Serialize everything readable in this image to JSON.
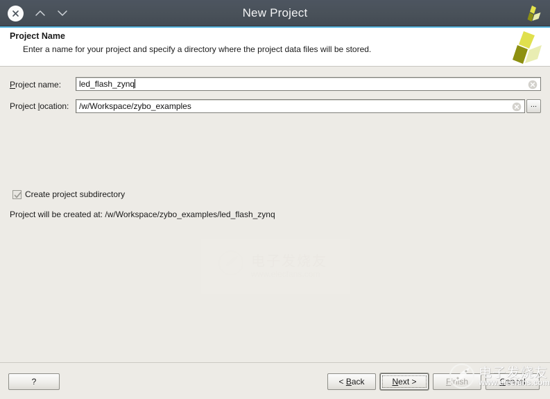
{
  "window": {
    "title": "New Project",
    "titlebar_buttons": [
      {
        "name": "close",
        "icon": "close-icon"
      },
      {
        "name": "maximize",
        "icon": "chevron-up-icon"
      },
      {
        "name": "minimize",
        "icon": "chevron-down-icon"
      }
    ],
    "logo_icon": "vivado-pinwheel-logo-icon",
    "accent_color": "#58b6e0",
    "titlebar_color": "#495159",
    "body_color": "#edebe6"
  },
  "header": {
    "title": "Project Name",
    "subtitle": "Enter a name for your project and specify a directory where the project data files will be stored.",
    "logo_icon": "vivado-pinwheel-logo-large-icon"
  },
  "form": {
    "project_name": {
      "label": "Project name:",
      "label_mnemonic": "P",
      "value": "led_flash_zynq",
      "clear_icon": "clear-circle-icon"
    },
    "project_location": {
      "label": "Project location:",
      "label_mnemonic": "l",
      "value": "/w/Workspace/zybo_examples",
      "clear_icon": "clear-circle-icon",
      "browse_label": "..."
    },
    "create_subdirectory": {
      "label": "Create project subdirectory",
      "checked": true,
      "check_icon": "checkmark-icon"
    },
    "created_at_text": "Project will be created at: /w/Workspace/zybo_examples/led_flash_zynq"
  },
  "footer": {
    "help_label": "?",
    "back_label": "< Back",
    "back_mnemonic": "B",
    "next_label": "Next >",
    "next_mnemonic": "N",
    "finish_label": "Finish",
    "finish_mnemonic": "F",
    "finish_enabled": false,
    "cancel_label": "Cancel",
    "cancel_mnemonic": "C",
    "focused_button": "Next >"
  },
  "watermark": {
    "text_cn": "电子发烧友",
    "text_url": "www.elecfans.com",
    "logo_icon": "elecfans-watermark-icon"
  }
}
